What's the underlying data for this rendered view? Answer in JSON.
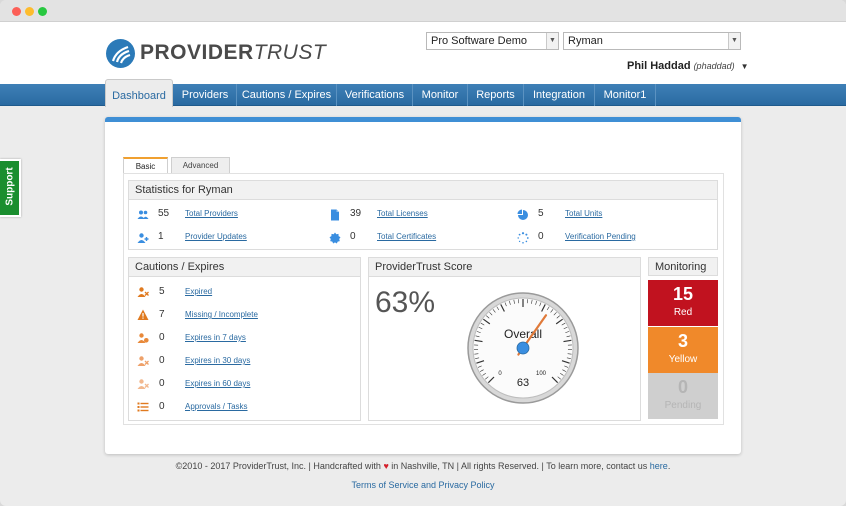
{
  "header": {
    "logo": {
      "brand_bold": "PROVIDER",
      "brand_light": "TRUST"
    },
    "account_select": "Pro Software Demo",
    "org_select": "Ryman",
    "user_name": "Phil Haddad",
    "user_handle": "(phaddad)"
  },
  "nav": [
    {
      "label": "Dashboard",
      "active": true
    },
    {
      "label": "Providers"
    },
    {
      "label": "Cautions / Expires"
    },
    {
      "label": "Verifications"
    },
    {
      "label": "Monitor"
    },
    {
      "label": "Reports"
    },
    {
      "label": "Integration"
    },
    {
      "label": "Monitor1"
    }
  ],
  "support_label": "Support",
  "tabs": {
    "basic": "Basic",
    "advanced": "Advanced"
  },
  "stats": {
    "title": "Statistics for Ryman",
    "items": [
      {
        "icon": "users-icon",
        "value": "55",
        "label": "Total Providers"
      },
      {
        "icon": "document-icon",
        "value": "39",
        "label": "Total Licenses"
      },
      {
        "icon": "pie-icon",
        "value": "5",
        "label": "Total Units"
      },
      {
        "icon": "user-plus-icon",
        "value": "1",
        "label": "Provider Updates"
      },
      {
        "icon": "certificate-icon",
        "value": "0",
        "label": "Total Certificates"
      },
      {
        "icon": "spinner-icon",
        "value": "0",
        "label": "Verification Pending"
      }
    ]
  },
  "cautions": {
    "title": "Cautions / Expires",
    "items": [
      {
        "icon": "user-x-icon",
        "value": "5",
        "label": "Expired",
        "color": "#e07a1f"
      },
      {
        "icon": "warning-icon",
        "value": "7",
        "label": "Missing / Incomplete",
        "color": "#e07a1f"
      },
      {
        "icon": "user-clock-icon",
        "value": "0",
        "label": "Expires in 7 days",
        "color": "#e8893a"
      },
      {
        "icon": "user-clock-icon",
        "value": "0",
        "label": "Expires in 30 days",
        "color": "#eea16a"
      },
      {
        "icon": "user-clock-icon",
        "value": "0",
        "label": "Expires in 60 days",
        "color": "#f2b88e"
      },
      {
        "icon": "list-icon",
        "value": "0",
        "label": "Approvals / Tasks",
        "color": "#e07a1f"
      }
    ]
  },
  "score": {
    "title": "ProviderTrust Score",
    "percent": "63%",
    "gauge_label": "Overall",
    "gauge_value": 63,
    "gauge_value_text": "63",
    "gauge_min": "0",
    "gauge_max": "100"
  },
  "monitoring": {
    "title": "Monitoring",
    "red": {
      "value": "15",
      "label": "Red"
    },
    "yellow": {
      "value": "3",
      "label": "Yellow"
    },
    "pending": {
      "value": "0",
      "label": "Pending"
    }
  },
  "footer": {
    "copyright": "©2010 - 2017 ProviderTrust, Inc.",
    "handcrafted_pre": "Handcrafted with",
    "handcrafted_post": "in Nashville, TN",
    "rights": "All rights Reserved.",
    "contact_pre": "To learn more, contact us",
    "contact_link": "here",
    "terms": "Terms of Service and Privacy Policy"
  },
  "colors": {
    "brand_blue": "#2a6aa1",
    "accent_orange": "#e07a1f",
    "red": "#c1121f",
    "yellow": "#f0892a"
  }
}
